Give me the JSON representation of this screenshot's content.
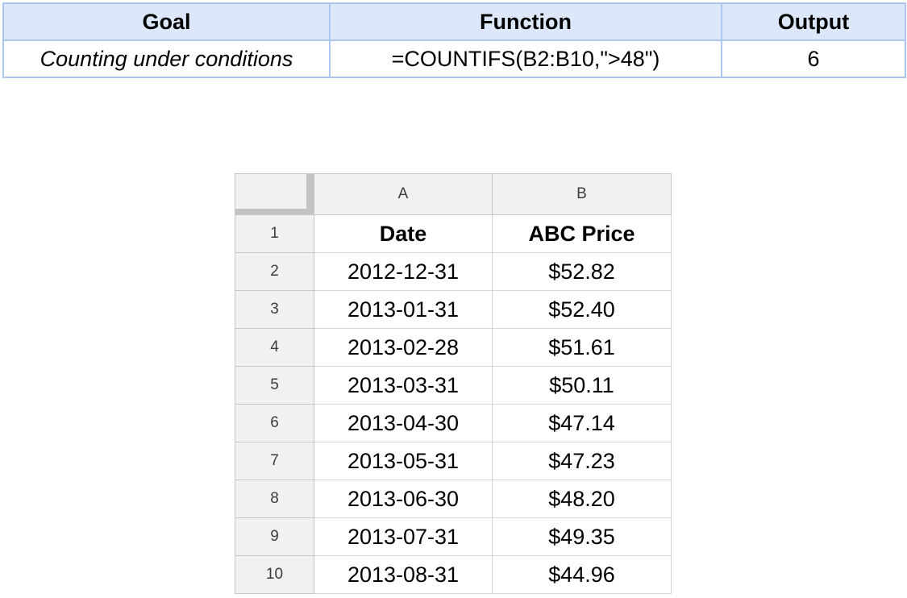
{
  "summary": {
    "headers": {
      "goal": "Goal",
      "function": "Function",
      "output": "Output"
    },
    "row": {
      "goal": "Counting under conditions",
      "function": "=COUNTIFS(B2:B10,\">48\")",
      "output": "6"
    }
  },
  "sheet": {
    "columns": [
      "A",
      "B"
    ],
    "rows": [
      {
        "num": "1",
        "a": "Date",
        "b": "ABC Price"
      },
      {
        "num": "2",
        "a": "2012-12-31",
        "b": "$52.82"
      },
      {
        "num": "3",
        "a": "2013-01-31",
        "b": "$52.40"
      },
      {
        "num": "4",
        "a": "2013-02-28",
        "b": "$51.61"
      },
      {
        "num": "5",
        "a": "2013-03-31",
        "b": "$50.11"
      },
      {
        "num": "6",
        "a": "2013-04-30",
        "b": "$47.14"
      },
      {
        "num": "7",
        "a": "2013-05-31",
        "b": "$47.23"
      },
      {
        "num": "8",
        "a": "2013-06-30",
        "b": "$48.20"
      },
      {
        "num": "9",
        "a": "2013-07-31",
        "b": "$49.35"
      },
      {
        "num": "10",
        "a": "2013-08-31",
        "b": "$44.96"
      }
    ]
  },
  "colors": {
    "summary_header_bg": "#dce8fa",
    "summary_border": "#adc6ee",
    "grid_header_bg": "#f1f1f1",
    "grid_line": "#d6d6d6"
  }
}
